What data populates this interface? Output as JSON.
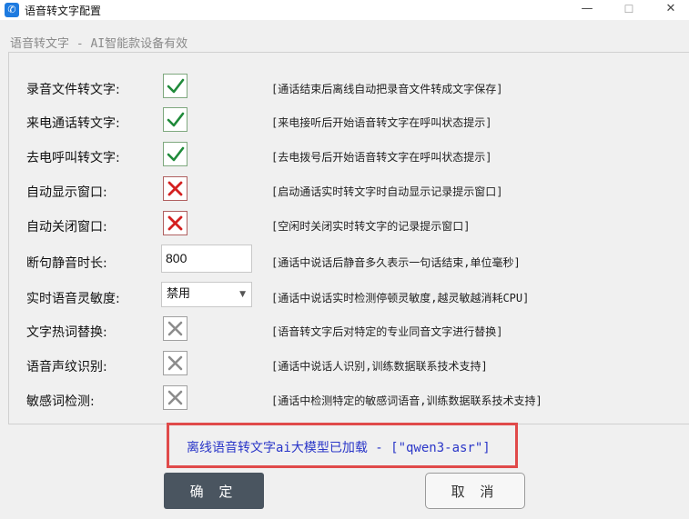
{
  "window": {
    "title": "语音转文字配置",
    "minimize": "—",
    "maximize": "☐",
    "close": "✕"
  },
  "subtitle": "语音转文字 - AI智能款设备有效",
  "rows": [
    {
      "label": "录音文件转文字:",
      "state": "checked",
      "desc": "[通话结束后离线自动把录音文件转成文字保存]"
    },
    {
      "label": "来电通话转文字:",
      "state": "checked",
      "desc": "[来电接听后开始语音转文字在呼叫状态提示]"
    },
    {
      "label": "去电呼叫转文字:",
      "state": "checked",
      "desc": "[去电拨号后开始语音转文字在呼叫状态提示]"
    },
    {
      "label": "自动显示窗口:",
      "state": "red-x",
      "desc": "[启动通话实时转文字时自动显示记录提示窗口]"
    },
    {
      "label": "自动关闭窗口:",
      "state": "red-x",
      "desc": "[空闲时关闭实时转文字的记录提示窗口]"
    },
    {
      "label": "断句静音时长:",
      "value": "800",
      "desc": "[通话中说话后静音多久表示一句话结束,单位毫秒]"
    },
    {
      "label": "实时语音灵敏度:",
      "selected": "禁用",
      "desc": "[通话中说话实时检测停顿灵敏度,越灵敏越消耗CPU]"
    },
    {
      "label": "文字热词替换:",
      "state": "disabled",
      "desc": "[语音转文字后对特定的专业同音文字进行替换]"
    },
    {
      "label": "语音声纹识别:",
      "state": "disabled",
      "desc": "[通话中说话人识别,训练数据联系技术支持]"
    },
    {
      "label": "敏感词检测:",
      "state": "disabled",
      "desc": "[通话中检测特定的敏感词语音,训练数据联系技术支持]"
    }
  ],
  "status": "离线语音转文字ai大模型已加载 - [\"qwen3-asr\"]",
  "buttons": {
    "ok": "确 定",
    "cancel": "取 消"
  },
  "colors": {
    "check_green": "#1f8a3a",
    "x_red": "#d42020",
    "x_gray": "#8c8c8c",
    "status_blue": "#2a36c8",
    "highlight_border": "#e04a4a"
  }
}
